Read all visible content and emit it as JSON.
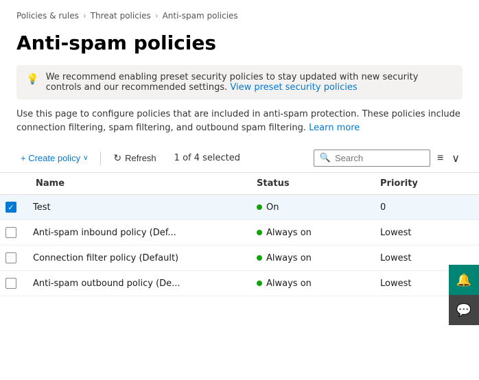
{
  "breadcrumb": {
    "items": [
      {
        "label": "Policies & rules",
        "href": "#"
      },
      {
        "label": "Threat policies",
        "href": "#"
      },
      {
        "label": "Anti-spam policies",
        "href": "#"
      }
    ]
  },
  "page": {
    "title": "Anti-spam policies",
    "banner_text": "We recommend enabling preset security policies to stay updated with new security controls and our recommended settings.",
    "banner_link_text": "View preset security policies",
    "description": "Use this page to configure policies that are included in anti-spam protection. These policies include connection filtering, spam filtering, and outbound spam filtering.",
    "description_link": "Learn more"
  },
  "toolbar": {
    "create_label": "+ Create policy",
    "refresh_label": "Refresh",
    "selected_count": "1 of 4 selected",
    "search_placeholder": "Search",
    "filter_icon": "≡",
    "chevron_icon": "∨"
  },
  "table": {
    "headers": [
      {
        "key": "checkbox",
        "label": ""
      },
      {
        "key": "name",
        "label": "Name"
      },
      {
        "key": "status",
        "label": "Status"
      },
      {
        "key": "priority",
        "label": "Priority"
      }
    ],
    "rows": [
      {
        "id": "row-1",
        "selected": true,
        "name": "Test",
        "status_label": "On",
        "status_color": "#13a10e",
        "priority": "0"
      },
      {
        "id": "row-2",
        "selected": false,
        "name": "Anti-spam inbound policy (Def...",
        "status_label": "Always on",
        "status_color": "#13a10e",
        "priority": "Lowest"
      },
      {
        "id": "row-3",
        "selected": false,
        "name": "Connection filter policy (Default)",
        "status_label": "Always on",
        "status_color": "#13a10e",
        "priority": "Lowest"
      },
      {
        "id": "row-4",
        "selected": false,
        "name": "Anti-spam outbound policy (De...",
        "status_label": "Always on",
        "status_color": "#13a10e",
        "priority": "Lowest"
      }
    ]
  },
  "right_panel": {
    "top_icon": "🔔",
    "bottom_icon": "💬"
  }
}
